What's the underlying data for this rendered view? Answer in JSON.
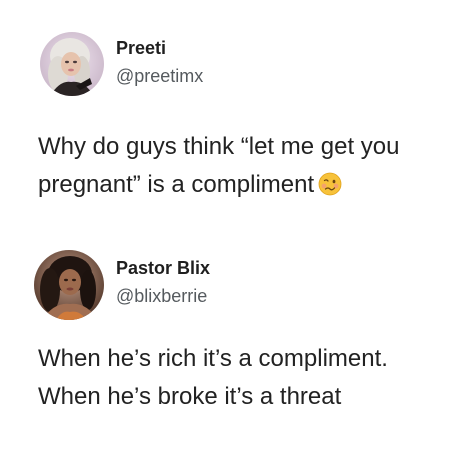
{
  "tweets": [
    {
      "display_name": "Preeti",
      "handle": "@preetimx",
      "avatar_icon": "profile-photo",
      "text_lines": [
        "Why do guys think “let me get you",
        "pregnant” is a compliment"
      ],
      "emoji_icon": "woozy-face-emoji"
    },
    {
      "display_name": "Pastor Blix",
      "handle": "@blixberrie",
      "avatar_icon": "profile-photo",
      "text_lines": [
        "When he’s rich it’s a compliment.",
        "When he’s broke it’s a threat"
      ]
    }
  ],
  "colors": {
    "background": "#ffffff",
    "text": "#222222",
    "handle": "#555a5e"
  }
}
